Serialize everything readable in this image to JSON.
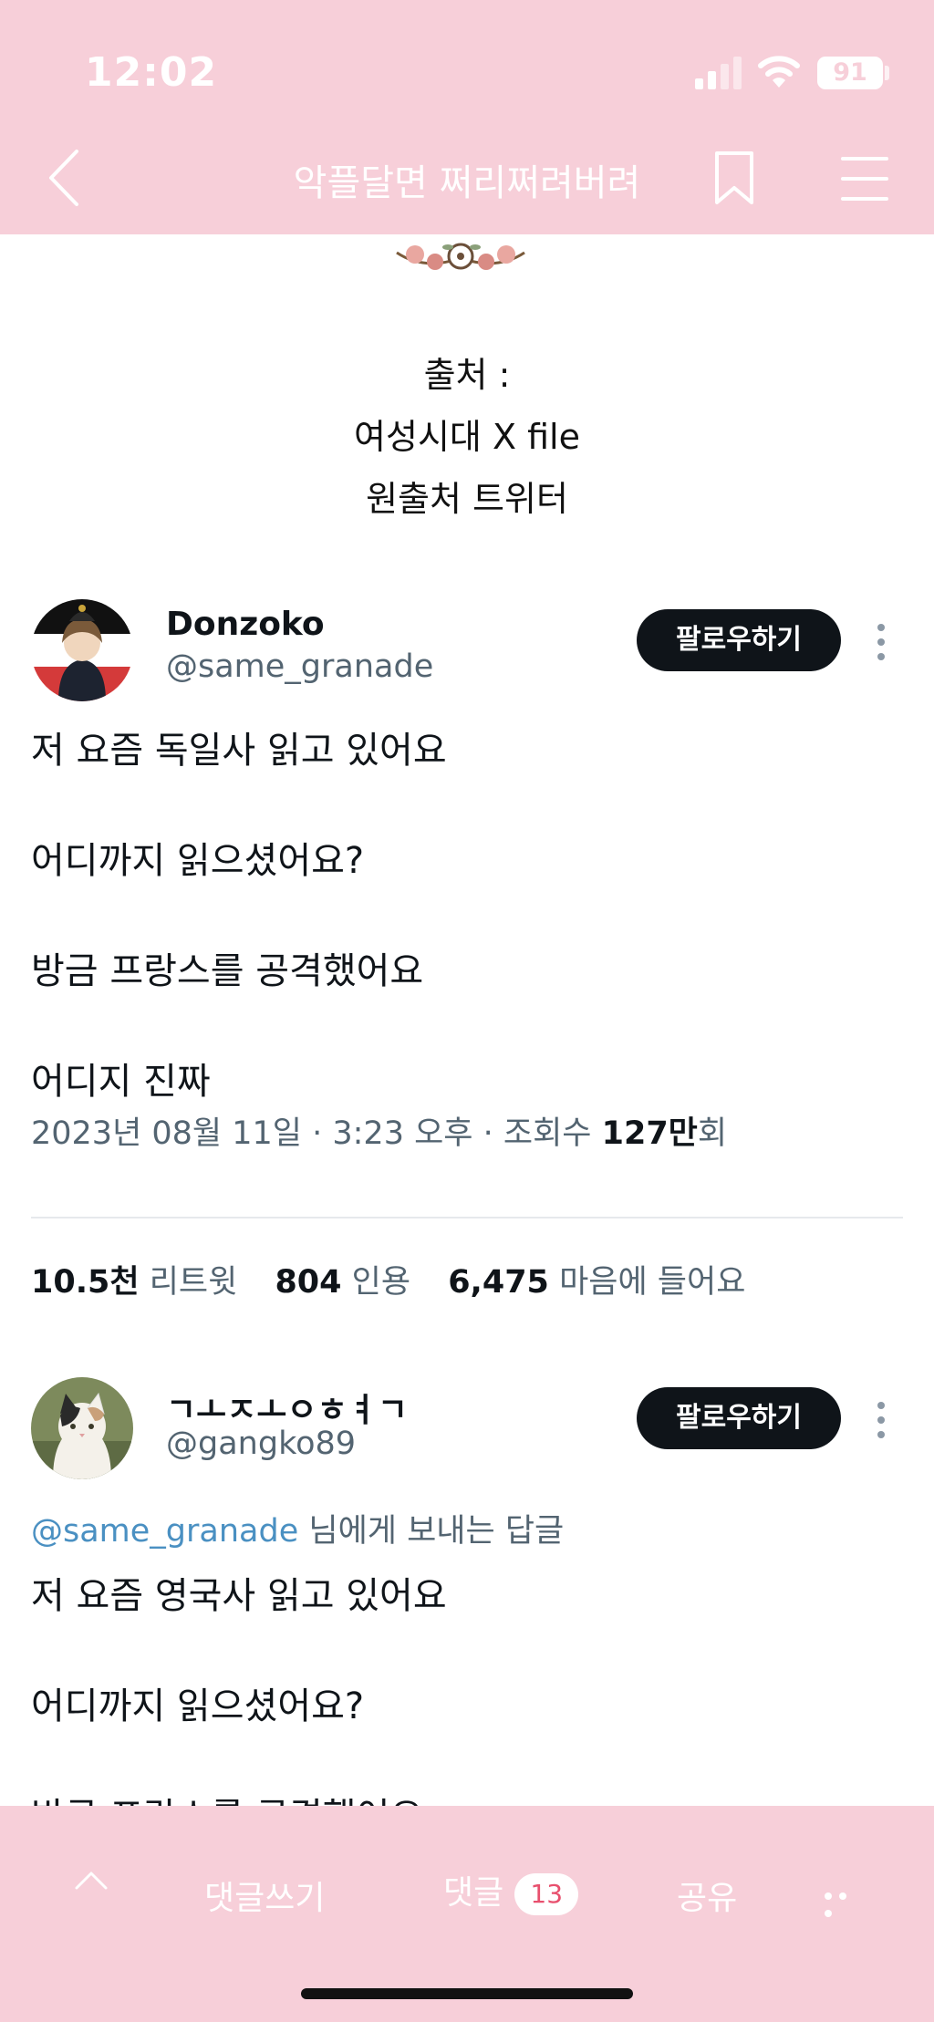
{
  "status": {
    "time": "12:02",
    "battery": "91"
  },
  "nav": {
    "title": "악플달면 쩌리쩌려버려"
  },
  "post": {
    "source_lines": [
      "출처 :",
      "여성시대 X file",
      "원출처 트위터"
    ]
  },
  "tweet1": {
    "name": "Donzoko",
    "handle": "@same_granade",
    "follow": "팔로우하기",
    "lines": [
      "저 요즘 독일사 읽고 있어요",
      "어디까지 읽으셨어요?",
      "방금 프랑스를 공격했어요",
      "어디지 진짜"
    ],
    "meta_prefix": "2023년 08월 11일 · 3:23 오후 · 조회수 ",
    "meta_views": "127만",
    "meta_suffix": "회",
    "stats": {
      "retweets_num": "10.5천",
      "retweets_label": "리트윗",
      "quotes_num": "804",
      "quotes_label": "인용",
      "likes_num": "6,475",
      "likes_label": "마음에 들어요"
    }
  },
  "tweet2": {
    "name": "ㄱㅗㅈㅗㅇㅎㅕㄱ",
    "handle": "@gangko89",
    "follow": "팔로우하기",
    "reply_mention": "@same_granade",
    "reply_text": " 님에게 보내는 답글",
    "lines": [
      "저 요즘 영국사 읽고 있어요",
      "어디까지 읽으셨어요?",
      "방금 프랑스를 공격했어요"
    ]
  },
  "bottom": {
    "write_comment": "댓글쓰기",
    "comments": "댓글",
    "comment_count": "13",
    "share": "공유"
  },
  "colors": {
    "bar": "#f7cfd9",
    "badge_text": "#e8506e",
    "mention": "#4a90c2"
  }
}
